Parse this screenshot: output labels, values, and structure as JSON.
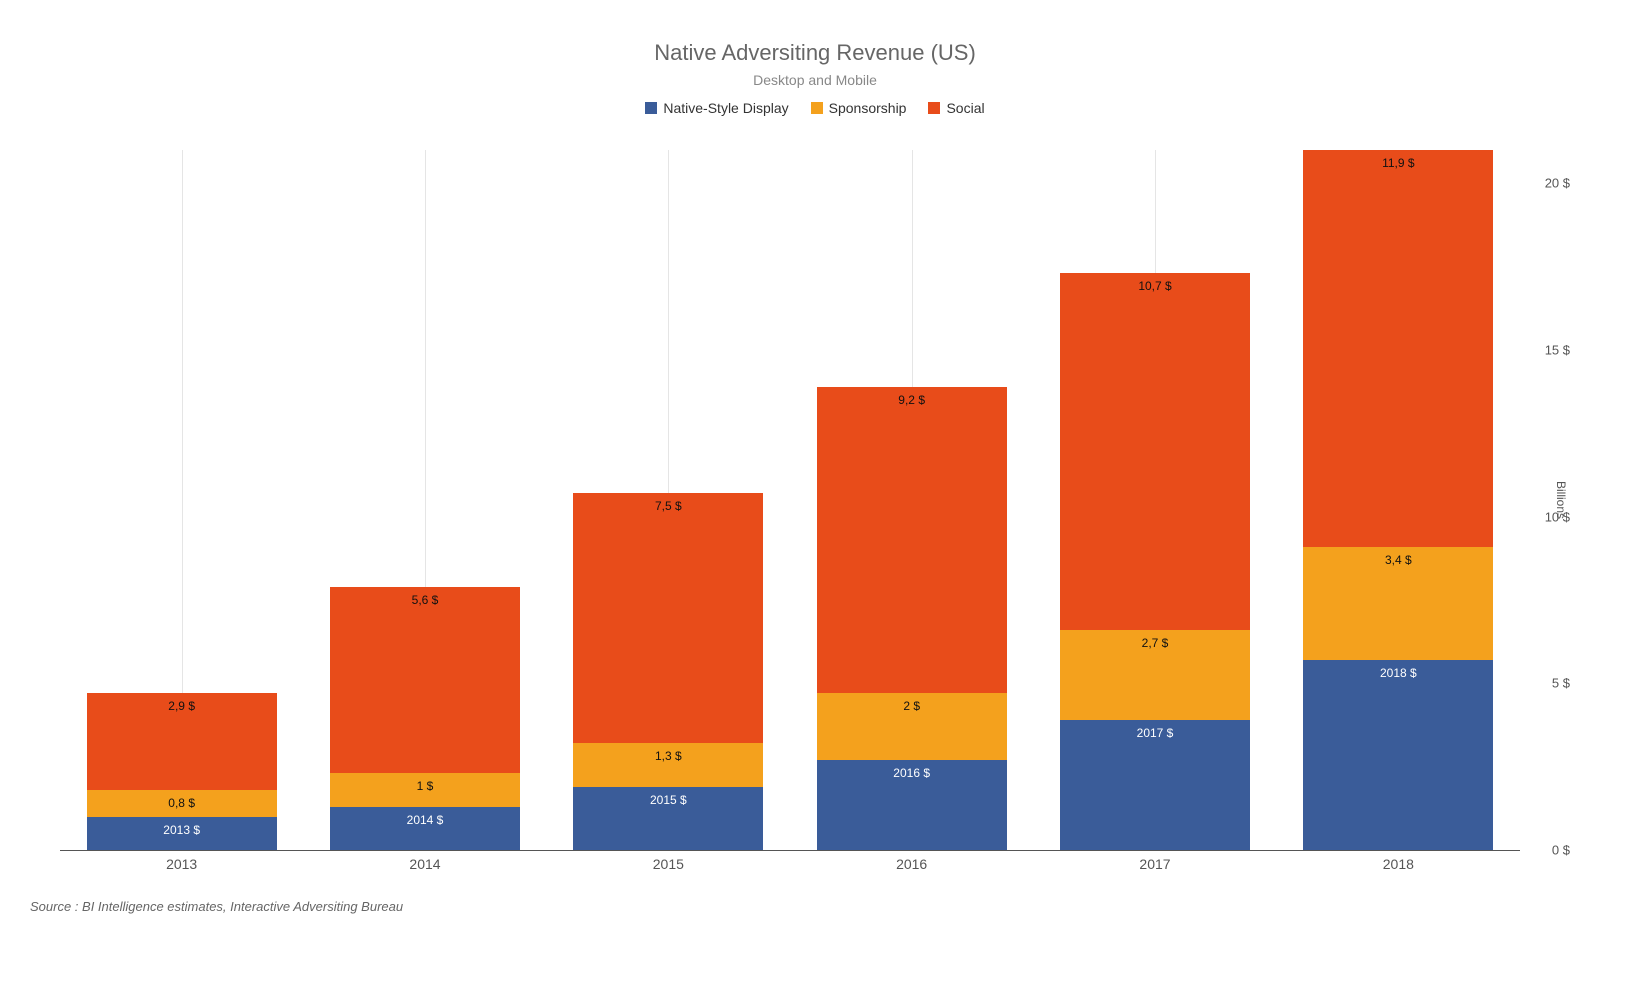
{
  "chart_data": {
    "type": "bar",
    "stacked": true,
    "title": "Native Adversiting Revenue (US)",
    "subtitle": "Desktop and Mobile",
    "categories": [
      "2013",
      "2014",
      "2015",
      "2016",
      "2017",
      "2018"
    ],
    "series": [
      {
        "name": "Native-Style Display",
        "color": "#3A5C99",
        "values": [
          1.0,
          1.3,
          1.9,
          2.7,
          3.9,
          5.7
        ]
      },
      {
        "name": "Sponsorship",
        "color": "#F4A11D",
        "values": [
          0.8,
          1.0,
          1.3,
          2.0,
          2.7,
          3.4
        ]
      },
      {
        "name": "Social",
        "color": "#E84C1A",
        "values": [
          2.9,
          5.6,
          7.5,
          9.2,
          10.7,
          11.9
        ]
      }
    ],
    "data_labels": {
      "native": [
        "2013 $",
        "2014 $",
        "2015 $",
        "2016 $",
        "2017 $",
        "2018 $"
      ],
      "sponsorship": [
        "0,8 $",
        "1 $",
        "1,3 $",
        "2 $",
        "2,7 $",
        "3,4 $"
      ],
      "social": [
        "2,9 $",
        "5,6 $",
        "7,5 $",
        "9,2 $",
        "10,7 $",
        "11,9 $"
      ]
    },
    "y_axis": {
      "title": "Billions",
      "ticks": [
        0,
        5,
        10,
        15,
        20
      ],
      "tick_labels": [
        "0 $",
        "5 $",
        "10 $",
        "15 $",
        "20 $"
      ],
      "max": 21
    },
    "legend_position": "top-center",
    "source": "Source : BI Intelligence estimates, Interactive Adversiting Bureau"
  }
}
